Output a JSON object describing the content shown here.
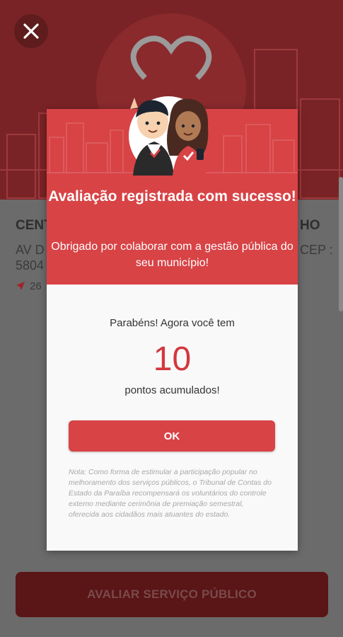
{
  "background": {
    "place_title": "CENT",
    "place_title_end": "HO",
    "address_line1": "AV D",
    "address_line1_end": "CEP :",
    "address_line2": "5804",
    "distance": "26",
    "cta_label": "AVALIAR SERVIÇO PÚBLICO"
  },
  "icons": {
    "close": "close-icon",
    "location": "navigation-arrow-icon",
    "heart": "heart-icon"
  },
  "modal": {
    "title": "Avaliação registrada com sucesso!",
    "subtitle": "Obrigado por colaborar com a gestão pública do seu município!",
    "congrats": "Parabéns! Agora você tem",
    "points": "10",
    "points_label": "pontos acumulados!",
    "ok_label": "OK",
    "note": "Nota: Como forma de estimular a participação popular no melhoramento dos serviços públicos, o Tribunal de Contas do Estado da Paraíba recompensará os voluntários do controle externo mediante cerimônia de premiação semestral, oferecida aos cidadãos mais atuantes do estado."
  },
  "colors": {
    "primary": "#d84346",
    "points": "#d3373b",
    "header_bg_dimmed": "#7a2326",
    "cta_dimmed": "#5a1517"
  }
}
